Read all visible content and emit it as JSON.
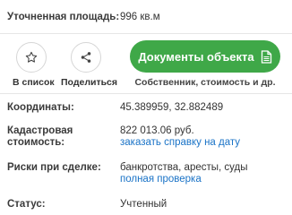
{
  "area": {
    "label": "Уточненная площадь:",
    "value": "996 кв.м"
  },
  "actions": {
    "favorite_label": "В список",
    "share_label": "Поделиться",
    "documents_button": "Документы объекта",
    "documents_subtitle": "Собственник, стоимость и др."
  },
  "coords": {
    "label": "Координаты:",
    "value": "45.389959, 32.882489"
  },
  "cadastral": {
    "label_line1": "Кадастровая",
    "label_line2": "стоимость:",
    "value": "822 013.06 руб.",
    "link": "заказать справку на дату"
  },
  "risks": {
    "label": "Риски при сделке:",
    "value": "банкротства, аресты, суды",
    "link": "полная проверка"
  },
  "status": {
    "label": "Статус:",
    "value": "Учтенный"
  },
  "colors": {
    "accent_green": "#3fa848",
    "link_blue": "#1a73c7"
  },
  "icons": [
    "star-icon",
    "share-icon",
    "document-icon"
  ]
}
